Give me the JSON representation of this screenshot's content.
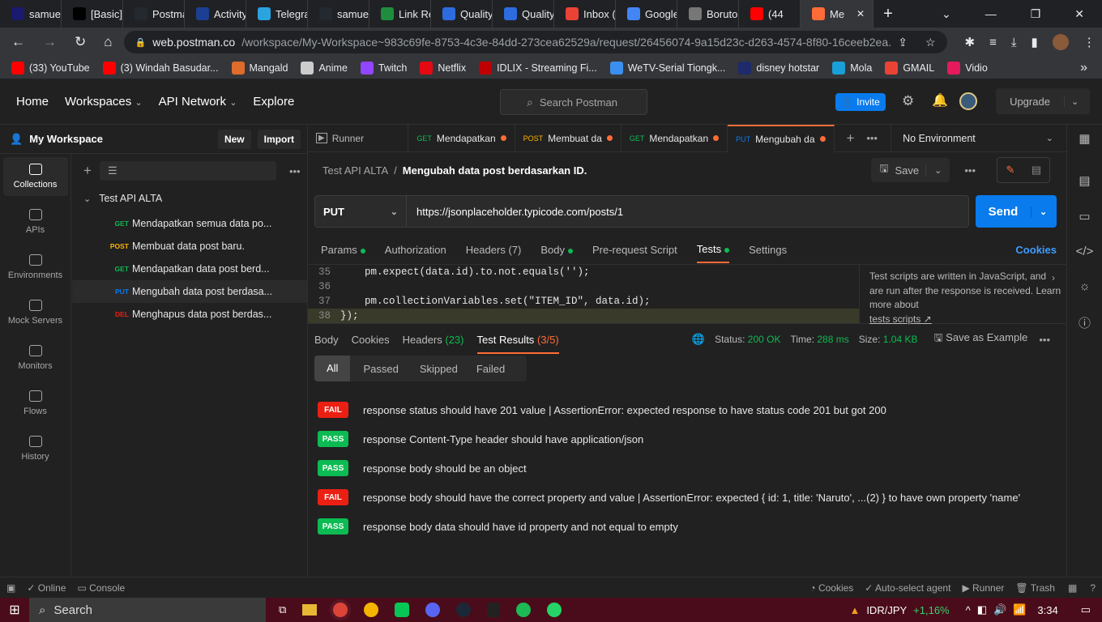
{
  "browser": {
    "tabs": [
      {
        "label": "samuel",
        "icon_color": "#1a1a6e"
      },
      {
        "label": "[Basic]",
        "icon_color": "#000000"
      },
      {
        "label": "Postma",
        "icon_color": "#24292f"
      },
      {
        "label": "Activity",
        "icon_color": "#1c3f94"
      },
      {
        "label": "Telegra",
        "icon_color": "#2aa3df"
      },
      {
        "label": "samuel",
        "icon_color": "#24292f"
      },
      {
        "label": "Link Re",
        "icon_color": "#1e8e3e"
      },
      {
        "label": "Quality",
        "icon_color": "#2d6cdf"
      },
      {
        "label": "Quality",
        "icon_color": "#2d6cdf"
      },
      {
        "label": "Inbox (",
        "icon_color": "#ea4335"
      },
      {
        "label": "Google",
        "icon_color": "#4285f4"
      },
      {
        "label": "Boruto",
        "icon_color": "#777777"
      },
      {
        "label": "(44",
        "icon_color": "#ff0000"
      },
      {
        "label": "Me",
        "icon_color": "#ff6c37"
      }
    ],
    "close_glyph": "✕",
    "new_tab_glyph": "+",
    "url_host": "web.postman.co",
    "url_path": "/workspace/My-Workspace~983c69fe-8753-4c3e-84dd-273cea62529a/request/26456074-9a15d23c-d263-4574-8f80-16ceeb2ea...",
    "bookmarks": [
      {
        "label": "(33) YouTube",
        "color": "#ff0000"
      },
      {
        "label": "(3) Windah Basudar...",
        "color": "#ff0000"
      },
      {
        "label": "Mangald",
        "color": "#e06c2b"
      },
      {
        "label": "Anime",
        "color": "#cccccc"
      },
      {
        "label": "Twitch",
        "color": "#9146ff"
      },
      {
        "label": "Netflix",
        "color": "#e50914"
      },
      {
        "label": "IDLIX - Streaming Fi...",
        "color": "#c00000"
      },
      {
        "label": "WeTV-Serial Tiongk...",
        "color": "#3b8ff0"
      },
      {
        "label": "disney hotstar",
        "color": "#1f2a6b"
      },
      {
        "label": "Mola",
        "color": "#1a9fd8"
      },
      {
        "label": "GMAIL",
        "color": "#ea4335"
      },
      {
        "label": "Vidio",
        "color": "#e5195b"
      }
    ],
    "more_glyph": "»"
  },
  "header": {
    "home": "Home",
    "workspaces": "Workspaces",
    "api_network": "API Network",
    "explore": "Explore",
    "search_placeholder": "Search Postman",
    "invite": "Invite",
    "upgrade": "Upgrade"
  },
  "sidebar": {
    "workspace_name": "My Workspace",
    "new_label": "New",
    "import_label": "Import",
    "rail": [
      {
        "label": "Collections"
      },
      {
        "label": "APIs"
      },
      {
        "label": "Environments"
      },
      {
        "label": "Mock Servers"
      },
      {
        "label": "Monitors"
      },
      {
        "label": "Flows"
      },
      {
        "label": "History"
      }
    ],
    "collection_name": "Test API ALTA",
    "requests": [
      {
        "method": "GET",
        "color": "#0cbb52",
        "name": "Mendapatkan semua data po..."
      },
      {
        "method": "POST",
        "color": "#ffb400",
        "name": "Membuat data post baru."
      },
      {
        "method": "GET",
        "color": "#0cbb52",
        "name": "Mendapatkan data post berd..."
      },
      {
        "method": "PUT",
        "color": "#097bed",
        "name": "Mengubah data post berdasa..."
      },
      {
        "method": "DEL",
        "color": "#eb2013",
        "name": "Menghapus data post berdas..."
      }
    ]
  },
  "tabs": {
    "runner": "Runner",
    "items": [
      {
        "method": "GET",
        "color": "#0cbb52",
        "label": "Mendapatkan"
      },
      {
        "method": "POST",
        "color": "#ffb400",
        "label": "Membuat da"
      },
      {
        "method": "GET",
        "color": "#0cbb52",
        "label": "Mendapatkan"
      },
      {
        "method": "PUT",
        "color": "#097bed",
        "label": "Mengubah da"
      }
    ],
    "environment": "No Environment"
  },
  "request": {
    "breadcrumb_collection": "Test API ALTA",
    "breadcrumb_sep": "/",
    "title": "Mengubah data post berdasarkan ID.",
    "save": "Save",
    "method": "PUT",
    "url": "https://jsonplaceholder.typicode.com/posts/1",
    "send": "Send",
    "subtabs": [
      "Params",
      "Authorization",
      "Headers",
      "Body",
      "Pre-request Script",
      "Tests",
      "Settings"
    ],
    "headers_count": "(7)",
    "cookies": "Cookies"
  },
  "code": {
    "lines": [
      {
        "n": "35",
        "text": "    pm.expect(data.id).to.not.equals('');"
      },
      {
        "n": "36",
        "text": ""
      },
      {
        "n": "37",
        "text": "    pm.collectionVariables.set(\"ITEM_ID\", data.id);"
      },
      {
        "n": "38",
        "text": "});"
      }
    ],
    "hint": "Test scripts are written in JavaScript, and are run after the response is received. Learn more about",
    "hint_link": "tests scripts ↗"
  },
  "response": {
    "tabs": [
      "Body",
      "Cookies",
      "Headers",
      "Test Results"
    ],
    "headers_count": "(23)",
    "test_count": "(3/5)",
    "status_label": "Status:",
    "status": "200 OK",
    "time_label": "Time:",
    "time": "288 ms",
    "size_label": "Size:",
    "size": "1.04 KB",
    "save_example": "Save as Example",
    "filters": [
      "All",
      "Passed",
      "Skipped",
      "Failed"
    ],
    "results": [
      {
        "status": "FAIL",
        "color": "#eb2013",
        "text": "response status should have 201 value | AssertionError: expected response to have status code 201 but got 200"
      },
      {
        "status": "PASS",
        "color": "#0cbb52",
        "text": "response Content-Type header should have application/json"
      },
      {
        "status": "PASS",
        "color": "#0cbb52",
        "text": "response body should be an object"
      },
      {
        "status": "FAIL",
        "color": "#eb2013",
        "text": "response body should have the correct property and value | AssertionError: expected { id: 1, title: 'Naruto', ...(2) } to have own property 'name'"
      },
      {
        "status": "PASS",
        "color": "#0cbb52",
        "text": "response body data should have id property and not equal to empty"
      }
    ]
  },
  "statusbar": {
    "online": "Online",
    "console": "Console",
    "cookies": "Cookies",
    "auto_select": "Auto-select agent",
    "runner": "Runner",
    "trash": "Trash"
  },
  "taskbar": {
    "search": "Search",
    "ticker": "IDR/JPY",
    "ticker_change": "+1,16%",
    "time": "3:34"
  }
}
